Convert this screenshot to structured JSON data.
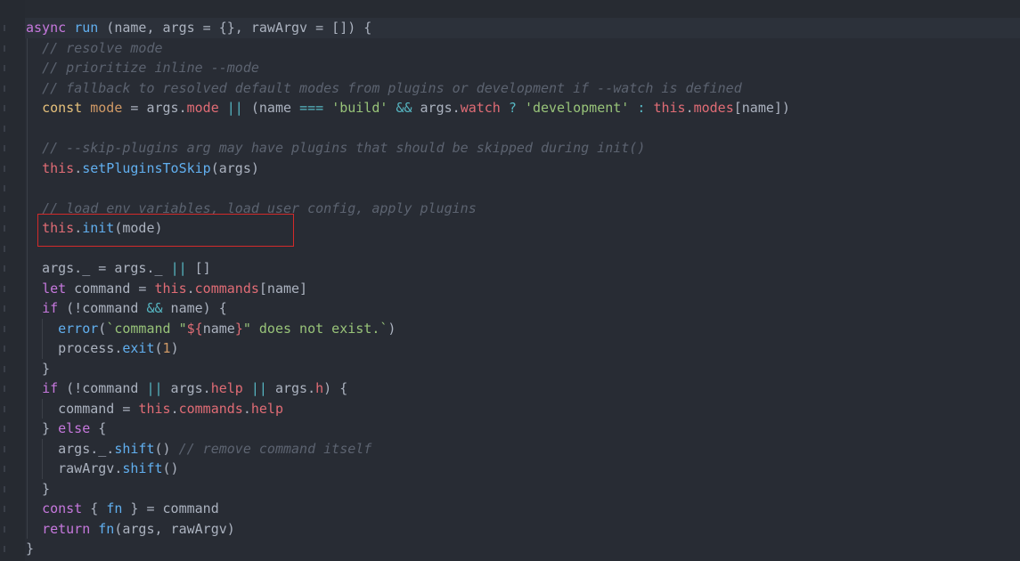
{
  "code_lines": [
    [
      [
        "kw",
        "async"
      ],
      [
        "pl",
        " "
      ],
      [
        "fn",
        "run"
      ],
      [
        "pl",
        " (name, args = {}, rawArgv = []) {"
      ]
    ],
    [
      [
        "pl",
        "  "
      ],
      [
        "cmt",
        "// resolve mode"
      ]
    ],
    [
      [
        "pl",
        "  "
      ],
      [
        "cmt",
        "// prioritize inline --mode"
      ]
    ],
    [
      [
        "pl",
        "  "
      ],
      [
        "cmt",
        "// fallback to resolved default modes from plugins or development if --watch is defined"
      ]
    ],
    [
      [
        "pl",
        "  "
      ],
      [
        "this",
        "const"
      ],
      [
        "pl",
        " "
      ],
      [
        "const",
        "mode"
      ],
      [
        "pl",
        " = args."
      ],
      [
        "prop",
        "mode"
      ],
      [
        "pl",
        " "
      ],
      [
        "op",
        "||"
      ],
      [
        "pl",
        " (name "
      ],
      [
        "op",
        "==="
      ],
      [
        "pl",
        " "
      ],
      [
        "str",
        "'build'"
      ],
      [
        "pl",
        " "
      ],
      [
        "op",
        "&&"
      ],
      [
        "pl",
        " args."
      ],
      [
        "prop",
        "watch"
      ],
      [
        "pl",
        " "
      ],
      [
        "op",
        "?"
      ],
      [
        "pl",
        " "
      ],
      [
        "str",
        "'development'"
      ],
      [
        "pl",
        " "
      ],
      [
        "op",
        ":"
      ],
      [
        "pl",
        " "
      ],
      [
        "prop",
        "this"
      ],
      [
        "pl",
        "."
      ],
      [
        "prop",
        "modes"
      ],
      [
        "pl",
        "[name])"
      ]
    ],
    [
      [
        "pl",
        ""
      ]
    ],
    [
      [
        "pl",
        "  "
      ],
      [
        "cmt",
        "// --skip-plugins arg may have plugins that should be skipped during init()"
      ]
    ],
    [
      [
        "pl",
        "  "
      ],
      [
        "prop",
        "this"
      ],
      [
        "pl",
        "."
      ],
      [
        "fn",
        "setPluginsToSkip"
      ],
      [
        "pl",
        "(args)"
      ]
    ],
    [
      [
        "pl",
        ""
      ]
    ],
    [
      [
        "pl",
        "  "
      ],
      [
        "cmt",
        "// load env variables, load user config, apply plugins"
      ]
    ],
    [
      [
        "pl",
        "  "
      ],
      [
        "prop",
        "this"
      ],
      [
        "pl",
        "."
      ],
      [
        "fn",
        "init"
      ],
      [
        "pl",
        "(mode)"
      ]
    ],
    [
      [
        "pl",
        ""
      ]
    ],
    [
      [
        "pl",
        "  args._ = args._ "
      ],
      [
        "op",
        "||"
      ],
      [
        "pl",
        " []"
      ]
    ],
    [
      [
        "pl",
        "  "
      ],
      [
        "kw",
        "let"
      ],
      [
        "pl",
        " command = "
      ],
      [
        "prop",
        "this"
      ],
      [
        "pl",
        "."
      ],
      [
        "prop",
        "commands"
      ],
      [
        "pl",
        "[name]"
      ]
    ],
    [
      [
        "pl",
        "  "
      ],
      [
        "kw",
        "if"
      ],
      [
        "pl",
        " (!command "
      ],
      [
        "op",
        "&&"
      ],
      [
        "pl",
        " name) {"
      ]
    ],
    [
      [
        "pl",
        "    "
      ],
      [
        "fn",
        "error"
      ],
      [
        "pl",
        "("
      ],
      [
        "tpl",
        "`command \""
      ],
      [
        "interp",
        "${"
      ],
      [
        "pl",
        "name"
      ],
      [
        "interp",
        "}"
      ],
      [
        "tpl",
        "\" does not exist.`"
      ],
      [
        "pl",
        ")"
      ]
    ],
    [
      [
        "pl",
        "    process."
      ],
      [
        "fn",
        "exit"
      ],
      [
        "pl",
        "("
      ],
      [
        "num",
        "1"
      ],
      [
        "pl",
        ")"
      ]
    ],
    [
      [
        "pl",
        "  }"
      ]
    ],
    [
      [
        "pl",
        "  "
      ],
      [
        "kw",
        "if"
      ],
      [
        "pl",
        " (!command "
      ],
      [
        "op",
        "||"
      ],
      [
        "pl",
        " args."
      ],
      [
        "prop",
        "help"
      ],
      [
        "pl",
        " "
      ],
      [
        "op",
        "||"
      ],
      [
        "pl",
        " args."
      ],
      [
        "prop",
        "h"
      ],
      [
        "pl",
        ") {"
      ]
    ],
    [
      [
        "pl",
        "    command = "
      ],
      [
        "prop",
        "this"
      ],
      [
        "pl",
        "."
      ],
      [
        "prop",
        "commands"
      ],
      [
        "pl",
        "."
      ],
      [
        "prop",
        "help"
      ]
    ],
    [
      [
        "pl",
        "  } "
      ],
      [
        "kw",
        "else"
      ],
      [
        "pl",
        " {"
      ]
    ],
    [
      [
        "pl",
        "    args._."
      ],
      [
        "fn",
        "shift"
      ],
      [
        "pl",
        "() "
      ],
      [
        "cmt",
        "// remove command itself"
      ]
    ],
    [
      [
        "pl",
        "    rawArgv."
      ],
      [
        "fn",
        "shift"
      ],
      [
        "pl",
        "()"
      ]
    ],
    [
      [
        "pl",
        "  }"
      ]
    ],
    [
      [
        "pl",
        "  "
      ],
      [
        "kw",
        "const"
      ],
      [
        "pl",
        " { "
      ],
      [
        "fn",
        "fn"
      ],
      [
        "pl",
        " } = command"
      ]
    ],
    [
      [
        "pl",
        "  "
      ],
      [
        "kw",
        "return"
      ],
      [
        "pl",
        " "
      ],
      [
        "fn",
        "fn"
      ],
      [
        "pl",
        "(args, rawArgv)"
      ]
    ],
    [
      [
        "pl",
        "}"
      ]
    ]
  ],
  "colors": {
    "background": "#282c34",
    "keyword": "#c678dd",
    "function": "#61afef",
    "string": "#98c379",
    "property": "#e06c75",
    "comment": "#5c6370",
    "highlight_box": "#d32a2a"
  }
}
